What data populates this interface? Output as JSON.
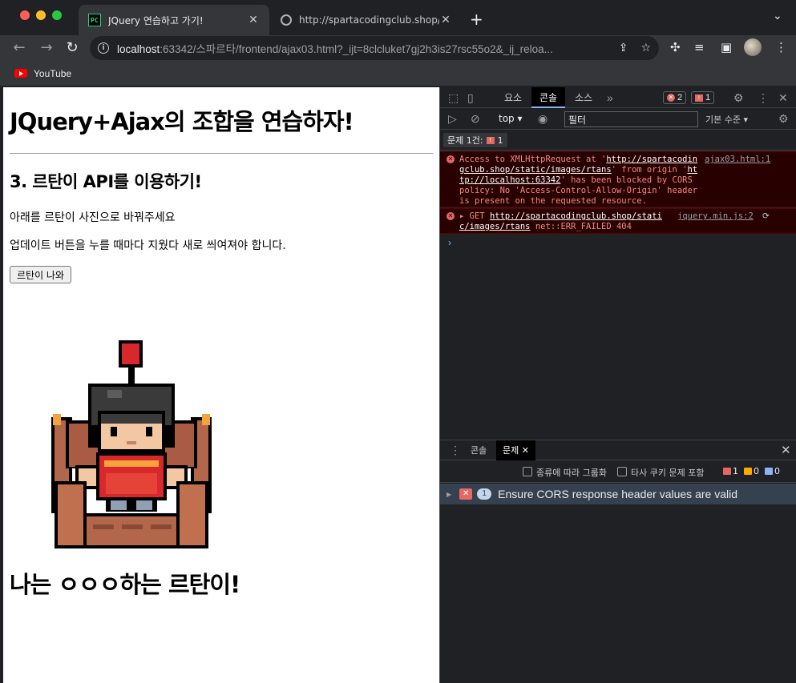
{
  "browser": {
    "active_tab_title": "JQuery 연습하고 가기!",
    "inactive_tab_title": "http://spartacodingclub.shop/s",
    "active_favicon": "PC",
    "url_host": "localhost",
    "url_rest": ":63342/스파르타/frontend/ajax03.html?_ijt=8clcluket7gj2h3is27rsc55o2&_ij_reloa...",
    "bookmark_label": "YouTube"
  },
  "page": {
    "title": "JQuery+Ajax의 조합을 연습하자!",
    "subtitle": "3. 르탄이 API를 이용하기!",
    "line1": "아래를 르탄이 사진으로 바꿔주세요",
    "line2": "업데이트 버튼을 누를 때마다 지웠다 새로 씌여져야 합니다.",
    "button_label": "르탄이 나와",
    "caption": "나는 ㅇㅇㅇ하는 르탄이!"
  },
  "devtools": {
    "tabs": [
      "요소",
      "콘솔",
      "소스"
    ],
    "active_tab": "콘솔",
    "error_count": "2",
    "issue_count": "1",
    "context": "top",
    "filter_value": "필터",
    "levels": "기본 수준",
    "issues_chip": "문제 1건:",
    "issues_chip_count": "1",
    "messages": [
      {
        "text_before": "Access to XMLHttpRequest at '",
        "link1": "http://spartacodingclub.shop/static/images/rtans",
        "text_mid": "' from origin '",
        "link2": "http://localhost:63342",
        "text_after": "' has been blocked by CORS policy: No 'Access-Control-Allow-Origin' header is present on the requested resource.",
        "source": "ajax03.html:1"
      },
      {
        "text_before": "GET ",
        "link1": "http://spartacodingclub.shop/static/images/rtans",
        "text_after": " net::ERR_FAILED 404",
        "source": "jquery.min.js:2"
      }
    ],
    "drawer_tabs": [
      "콘솔",
      "문제"
    ],
    "drawer_active": "문제",
    "group_by_kind": "종류에 따라 그룹화",
    "third_party": "타사 쿠키 문제 포함",
    "count_errors": "1",
    "count_warnings": "0",
    "count_info": "0",
    "issue_title": "Ensure CORS response header values are valid",
    "issue_badge": "1"
  },
  "colors": {
    "error": "#e46962",
    "warning": "#f9ab00",
    "info": "#8ab4f8",
    "issue_row": "#35414f"
  }
}
